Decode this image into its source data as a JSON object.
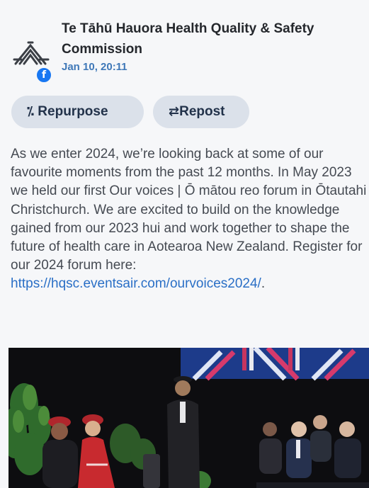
{
  "post": {
    "author": "Te Tāhū Hauora Health Quality & Safety Commission",
    "timestamp": "Jan 10, 20:11",
    "platform_icon": "facebook-icon",
    "text_before_link": "As we enter 2024, we’re looking back at some of our favourite moments from the past 12 months. In May 2023 we held our first Our voices | Ō mātou reo forum in Ōtautahi Christchurch. We are excited to build on the knowledge gained from our 2023 hui and work together to shape the future of health care in Aotearoa New Zealand. Register for our 2024 forum here: ",
    "link_text": "https://hqsc.eventsair.com/ourvoices2024/",
    "text_after_link": "."
  },
  "actions": {
    "repurpose_label": "Repurpose",
    "repurpose_icon": "magic-wand-icon",
    "repost_label": "Repost",
    "repost_icon": "repost-arrows-icon"
  },
  "colors": {
    "background": "#f6f7f9",
    "button_bg": "#dbe1ea",
    "button_text": "#22324a",
    "link": "#2a6fc6",
    "date": "#3f78b8",
    "facebook": "#1877f2"
  }
}
